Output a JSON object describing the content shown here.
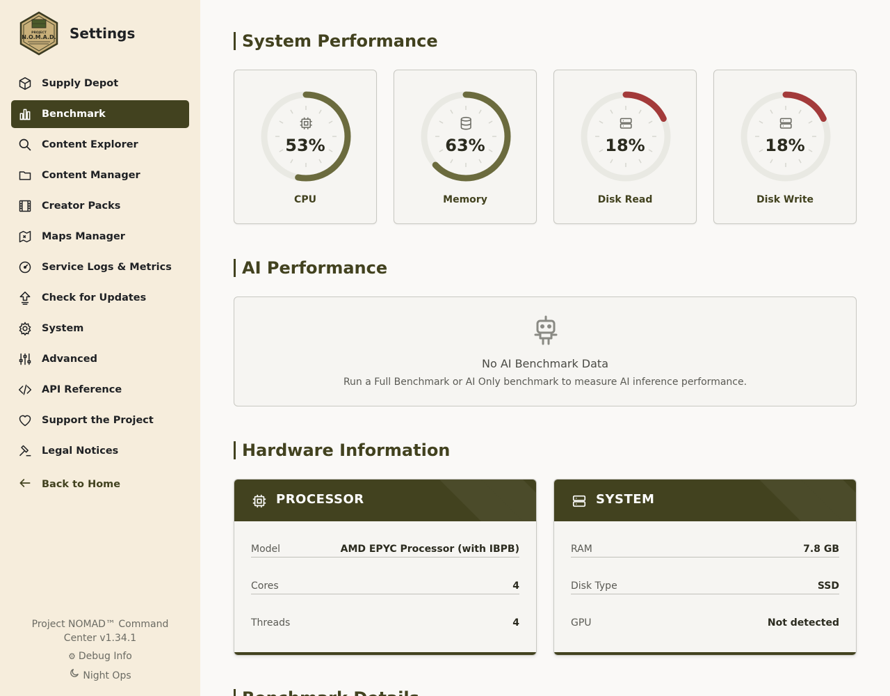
{
  "app": {
    "title": "Settings"
  },
  "sidebar": {
    "items": [
      {
        "label": "Supply Depot",
        "icon": "box-icon"
      },
      {
        "label": "Benchmark",
        "icon": "chart-icon",
        "active": true
      },
      {
        "label": "Content Explorer",
        "icon": "search-icon"
      },
      {
        "label": "Content Manager",
        "icon": "folder-icon"
      },
      {
        "label": "Creator Packs",
        "icon": "film-icon"
      },
      {
        "label": "Maps Manager",
        "icon": "map-icon"
      },
      {
        "label": "Service Logs & Metrics",
        "icon": "gauge-icon"
      },
      {
        "label": "Check for Updates",
        "icon": "upload-icon"
      },
      {
        "label": "System",
        "icon": "gear-icon"
      },
      {
        "label": "Advanced",
        "icon": "sliders-icon"
      },
      {
        "label": "API Reference",
        "icon": "code-icon"
      },
      {
        "label": "Support the Project",
        "icon": "heart-icon"
      },
      {
        "label": "Legal Notices",
        "icon": "gavel-icon"
      }
    ],
    "back_label": "Back to Home",
    "footer": {
      "version": "Project NOMAD™ Command Center v1.34.1",
      "debug_label": "Debug Info",
      "night_label": "Night Ops"
    }
  },
  "system_performance": {
    "title": "System Performance",
    "gauges": [
      {
        "label": "CPU",
        "percent": 53,
        "display": "53%",
        "color": "#6b6b3e",
        "icon": "chip-icon"
      },
      {
        "label": "Memory",
        "percent": 63,
        "display": "63%",
        "color": "#6b6b3e",
        "icon": "database-icon"
      },
      {
        "label": "Disk Read",
        "percent": 18,
        "display": "18%",
        "color": "#a33a3a",
        "icon": "server-icon"
      },
      {
        "label": "Disk Write",
        "percent": 18,
        "display": "18%",
        "color": "#a33a3a",
        "icon": "server-icon"
      }
    ]
  },
  "ai_performance": {
    "title": "AI Performance",
    "empty_title": "No AI Benchmark Data",
    "empty_desc": "Run a Full Benchmark or AI Only benchmark to measure AI inference performance."
  },
  "hardware": {
    "title": "Hardware Information",
    "processor": {
      "title": "PROCESSOR",
      "rows": [
        {
          "key": "Model",
          "value": "AMD EPYC Processor (with IBPB)"
        },
        {
          "key": "Cores",
          "value": "4"
        },
        {
          "key": "Threads",
          "value": "4"
        }
      ]
    },
    "system": {
      "title": "SYSTEM",
      "rows": [
        {
          "key": "RAM",
          "value": "7.8 GB"
        },
        {
          "key": "Disk Type",
          "value": "SSD"
        },
        {
          "key": "GPU",
          "value": "Not detected"
        }
      ]
    }
  },
  "benchmark_details": {
    "title": "Benchmark Details"
  },
  "colors": {
    "accent": "#42421f",
    "sidebar_bg": "#f6eddc",
    "gauge_ok": "#6b6b3e",
    "gauge_low": "#a33a3a"
  }
}
